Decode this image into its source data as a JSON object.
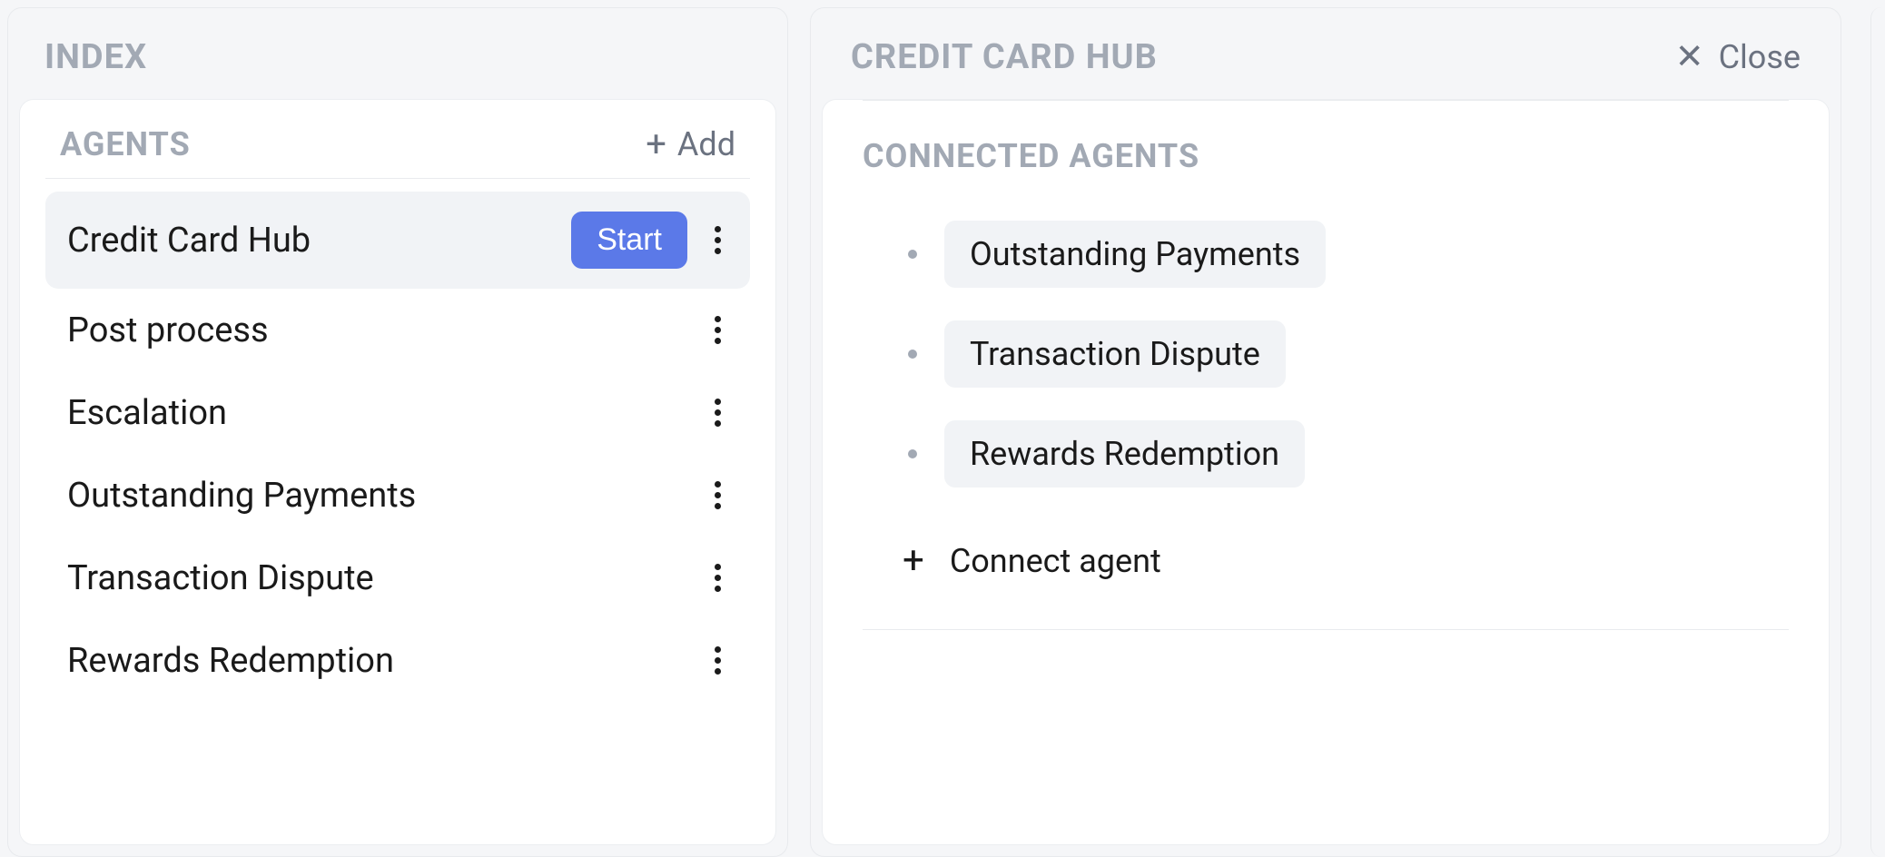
{
  "index": {
    "title": "INDEX",
    "agents_label": "AGENTS",
    "add_label": "Add",
    "start_label": "Start",
    "agents": [
      {
        "name": "Credit Card Hub",
        "active": true,
        "show_start": true
      },
      {
        "name": "Post process",
        "active": false,
        "show_start": false
      },
      {
        "name": "Escalation",
        "active": false,
        "show_start": false
      },
      {
        "name": "Outstanding Payments",
        "active": false,
        "show_start": false
      },
      {
        "name": "Transaction Dispute",
        "active": false,
        "show_start": false
      },
      {
        "name": "Rewards Redemption",
        "active": false,
        "show_start": false
      }
    ]
  },
  "detail": {
    "title": "CREDIT CARD HUB",
    "close_label": "Close",
    "connected_label": "CONNECTED AGENTS",
    "connected": [
      "Outstanding Payments",
      "Transaction Dispute",
      "Rewards Redemption"
    ],
    "connect_agent_label": "Connect agent"
  }
}
